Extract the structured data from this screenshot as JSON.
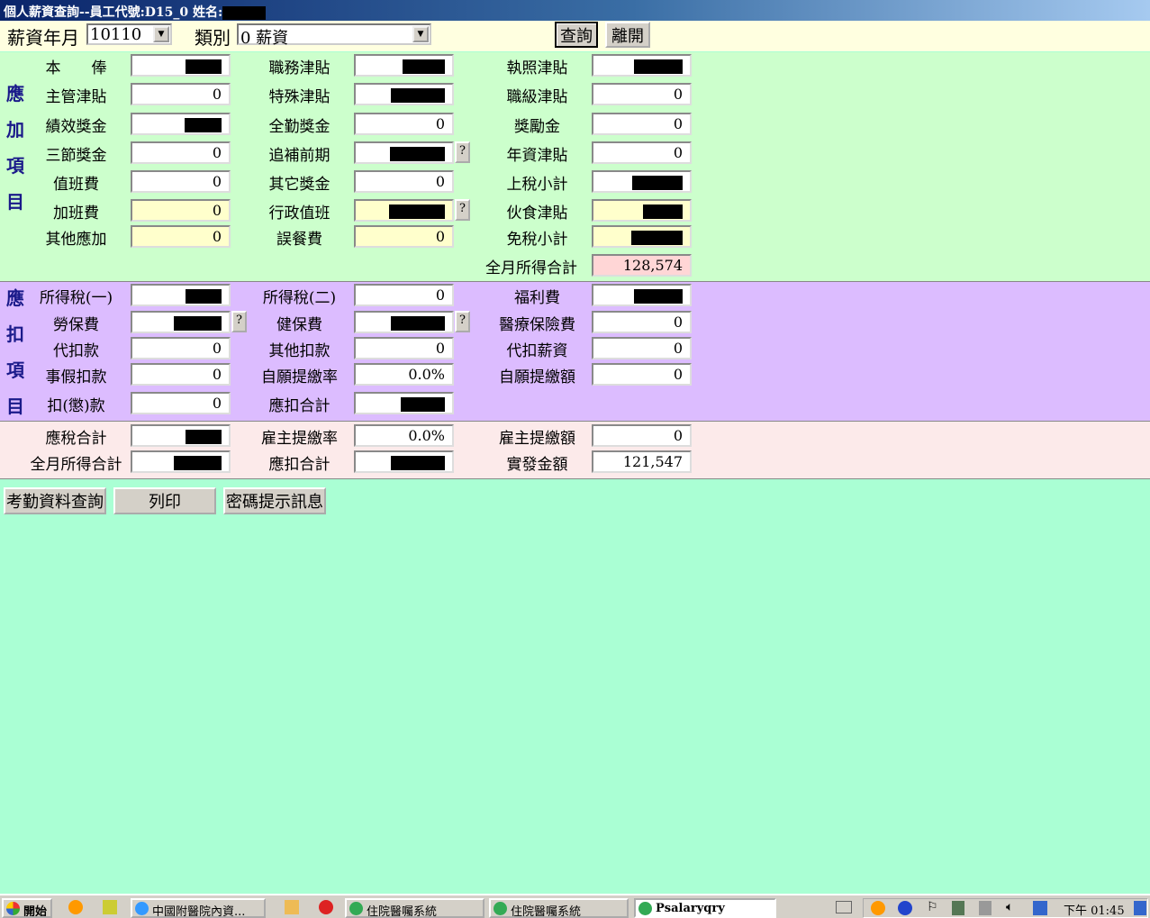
{
  "window": {
    "title": "個人薪資查詢--員工代號:D15_0 姓名:"
  },
  "toolbar": {
    "period_label": "薪資年月",
    "period_value": "10110",
    "category_label": "類別",
    "category_value": "0  薪資",
    "query_label": "查詢",
    "exit_label": "離開"
  },
  "sections": [
    {
      "id": "earnings",
      "side": [
        "應",
        "加",
        "項",
        "目"
      ],
      "columns": [
        [
          {
            "label": "本　　俸",
            "redacted": true
          },
          {
            "label": "主管津貼",
            "value": "0"
          },
          {
            "label": "績效獎金",
            "redacted": true
          },
          {
            "label": "三節獎金",
            "value": "0"
          },
          {
            "label": "值班費",
            "value": "0"
          },
          {
            "label": "加班費",
            "value": "0",
            "bg": "y"
          },
          {
            "label": "其他應加",
            "value": "0",
            "bg": "y"
          }
        ],
        [
          {
            "label": "職務津貼",
            "redacted": true
          },
          {
            "label": "特殊津貼",
            "redacted": true
          },
          {
            "label": "全勤獎金",
            "value": "0"
          },
          {
            "label": "追補前期",
            "redacted": true,
            "help": "?"
          },
          {
            "label": "其它獎金",
            "value": "0"
          },
          {
            "label": "行政值班",
            "redacted": true,
            "bg": "y",
            "help": "?"
          },
          {
            "label": "誤餐費",
            "value": "0",
            "bg": "y"
          }
        ],
        [
          {
            "label": "執照津貼",
            "redacted": true
          },
          {
            "label": "職級津貼",
            "value": "0"
          },
          {
            "label": "獎勵金",
            "value": "0"
          },
          {
            "label": "年資津貼",
            "value": "0"
          },
          {
            "label": "上稅小計",
            "redacted": true
          },
          {
            "label": "伙食津貼",
            "redacted": true,
            "bg": "y"
          },
          {
            "label": "免稅小計",
            "redacted": true,
            "bg": "y"
          },
          {
            "label": "全月所得合計",
            "value": "128,574",
            "bg": "p"
          }
        ]
      ]
    },
    {
      "id": "deductions",
      "side": [
        "應",
        "扣",
        "項",
        "目"
      ],
      "columns": [
        [
          {
            "label": "所得稅(一)",
            "redacted": true
          },
          {
            "label": "勞保費",
            "redacted": true,
            "help": "?"
          },
          {
            "label": "代扣款",
            "value": "0"
          },
          {
            "label": "事假扣款",
            "value": "0"
          },
          {
            "label": "扣(懲)款",
            "value": "0"
          }
        ],
        [
          {
            "label": "所得稅(二)",
            "value": "0"
          },
          {
            "label": "健保費",
            "redacted": true,
            "help": "?"
          },
          {
            "label": "其他扣款",
            "value": "0"
          },
          {
            "label": "自願提繳率",
            "value": "0.0%"
          },
          {
            "label": "應扣合計",
            "redacted": true
          }
        ],
        [
          {
            "label": "福利費",
            "redacted": true
          },
          {
            "label": "醫療保險費",
            "value": "0"
          },
          {
            "label": "代扣薪資",
            "value": "0"
          },
          {
            "label": "自願提繳額",
            "value": "0"
          }
        ]
      ]
    },
    {
      "id": "summary",
      "side": [],
      "columns": [
        [
          {
            "label": "應稅合計",
            "redacted": true
          },
          {
            "label": "全月所得合計",
            "redacted": true
          }
        ],
        [
          {
            "label": "雇主提繳率",
            "value": "0.0%"
          },
          {
            "label": "應扣合計",
            "redacted": true
          }
        ],
        [
          {
            "label": "雇主提繳額",
            "value": "0"
          },
          {
            "label": "實發金額",
            "value": "121,547"
          }
        ]
      ]
    }
  ],
  "actions": [
    "考勤資料查詢",
    "列印",
    "密碼提示訊息"
  ],
  "taskbar": {
    "start": "開始",
    "tasks": [
      "中國附醫院內資...",
      "住院醫囑系統",
      "住院醫囑系統",
      "Psalaryqry"
    ],
    "clock": "下午 01:45"
  }
}
